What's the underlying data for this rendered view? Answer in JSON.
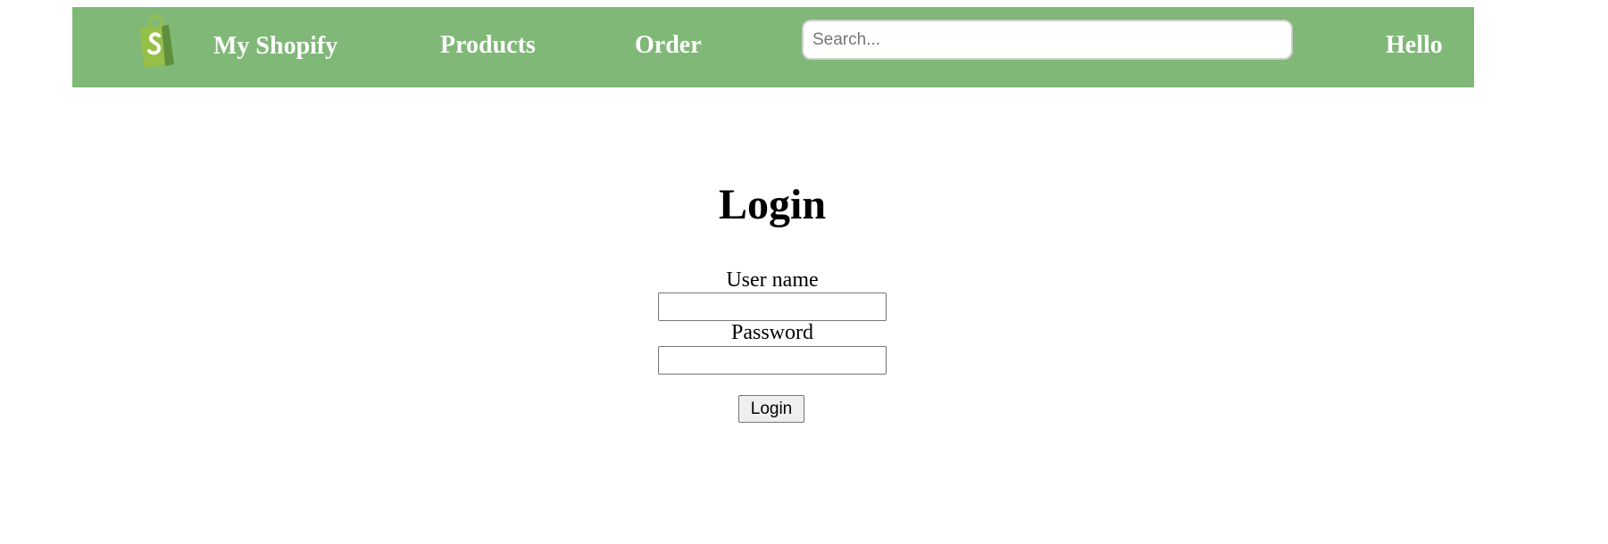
{
  "header": {
    "logo_icon": "shopify-bag-icon",
    "brand": "My Shopify",
    "nav": {
      "products": "Products",
      "order": "Order"
    },
    "search": {
      "placeholder": "Search...",
      "value": ""
    },
    "greeting": "Hello"
  },
  "login": {
    "title": "Login",
    "username_label": "User name",
    "username_value": "",
    "password_label": "Password",
    "password_value": "",
    "submit_label": "Login"
  },
  "colors": {
    "navbar": "#80b877",
    "nav_text": "#ffffff",
    "logo_bag": "#95bf47",
    "logo_bag_shade": "#5e8e3e"
  }
}
